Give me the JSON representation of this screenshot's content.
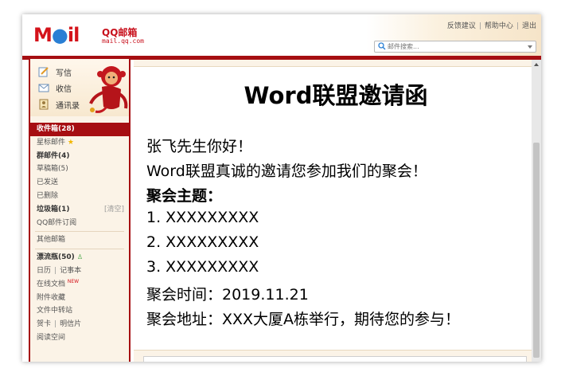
{
  "header": {
    "logo_mail": "M ail",
    "logo_brand": "QQ邮箱",
    "logo_domain": "mail.qq.com",
    "links": [
      "反馈建议",
      "帮助中心",
      "退出"
    ],
    "search_placeholder": "邮件搜索..."
  },
  "sidebar": {
    "quick": [
      {
        "label": "写信",
        "icon": "pencil-icon"
      },
      {
        "label": "收信",
        "icon": "inbox-icon"
      },
      {
        "label": "通讯录",
        "icon": "contacts-icon"
      }
    ],
    "folders": {
      "inbox": "收件箱(28)",
      "starred": "星标邮件",
      "group": "群邮件(4)",
      "drafts": "草稿箱(5)",
      "sent": "已发送",
      "deleted": "已删除",
      "spam": "垃圾箱(1)",
      "spam_clear": "[清空]",
      "subscribe": "QQ邮件订阅",
      "other": "其他邮箱",
      "bottle": "漂流瓶(50)",
      "calendar": "日历",
      "notes": "记事本",
      "docs": "在线文档",
      "docs_badge": "NEW",
      "favorites": "附件收藏",
      "transfer": "文件中转站",
      "cards": "贺卡",
      "postcards": "明信片",
      "reading": "阅读空间"
    }
  },
  "email": {
    "title": "Word联盟邀请函",
    "greeting": "张飞先生你好！",
    "intro": "Word联盟真诚的邀请您参加我们的聚会！",
    "topic_label": "聚会主题：",
    "items": [
      "1.  XXXXXXXXX",
      "2.  XXXXXXXXX",
      "3.  XXXXXXXXX"
    ],
    "time": "聚会时间：2019.11.21",
    "place": "聚会地址：XXX大厦A栋举行，期待您的参与！"
  },
  "colors": {
    "brand_red": "#a60e12",
    "sidebar_bg": "#fbf3e7",
    "logo_blue": "#2a7fd4"
  }
}
